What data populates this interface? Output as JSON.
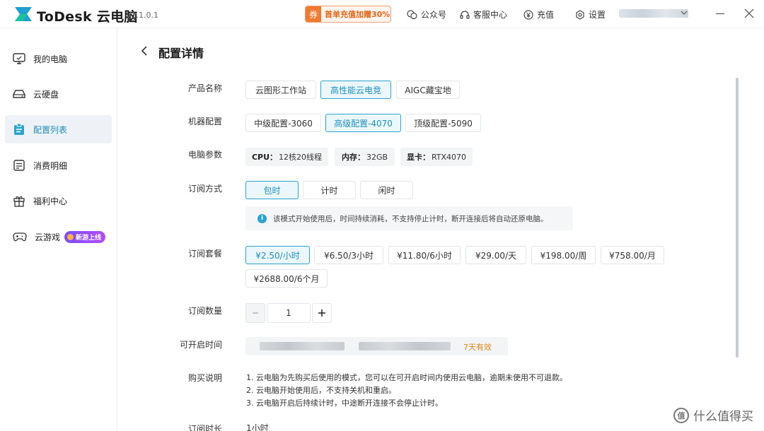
{
  "app": {
    "brand": "ToDesk 云电脑",
    "version": "V1.1.0.1",
    "promo_badge": "券",
    "promo_text": "首单充值加赠30%",
    "toolbar": [
      "公众号",
      "客服中心",
      "充值",
      "设置"
    ],
    "accent_color": "#2aa3cf"
  },
  "sidebar": {
    "items": [
      {
        "label": "我的电脑",
        "icon": "monitor-icon"
      },
      {
        "label": "云硬盘",
        "icon": "disk-icon"
      },
      {
        "label": "配置列表",
        "icon": "clipboard-icon"
      },
      {
        "label": "消费明细",
        "icon": "bill-icon"
      },
      {
        "label": "福利中心",
        "icon": "gift-icon"
      },
      {
        "label": "云游戏",
        "icon": "gamepad-icon",
        "badge": "新游上线"
      }
    ],
    "active_index": 2
  },
  "page": {
    "title": "配置详情",
    "labels": {
      "product": "产品名称",
      "machine": "机器配置",
      "params": "电脑参数",
      "mode": "订阅方式",
      "package": "订阅套餐",
      "quantity": "订阅数量",
      "start_time": "可开启时间",
      "purchase": "购买说明",
      "duration": "订阅时长"
    },
    "products": [
      "云图形工作站",
      "高性能云电竞",
      "AIGC藏宝地"
    ],
    "machines": [
      "中级配置-3060",
      "高级配置-4070",
      "顶级配置-5090"
    ],
    "specs": [
      {
        "k": "CPU：",
        "v": "12核20线程"
      },
      {
        "k": "内存：",
        "v": "32GB"
      },
      {
        "k": "显卡：",
        "v": "RTX4070"
      }
    ],
    "modes": [
      "包时",
      "计时",
      "闲时"
    ],
    "notice": "该模式开始使用后，时间持续消耗，不支持停止计时，断开连接后将自动还原电脑。",
    "packages": [
      "¥2.50/小时",
      "¥6.50/3小时",
      "¥11.80/6小时",
      "¥29.00/天",
      "¥198.00/周",
      "¥758.00/月",
      "¥2688.00/6个月"
    ],
    "quantity": "1",
    "validity": "7天有效",
    "descriptions": [
      "1. 云电脑为先购买后使用的模式，您可以在可开启时间内使用云电脑，逾期未使用不可退款。",
      "2. 云电脑开始使用后，不支持关机和重启。",
      "3. 云电脑开启后持续计时，中途断开连接不会停止计时。"
    ],
    "duration_value": "1小时"
  },
  "watermark": "什么值得买"
}
